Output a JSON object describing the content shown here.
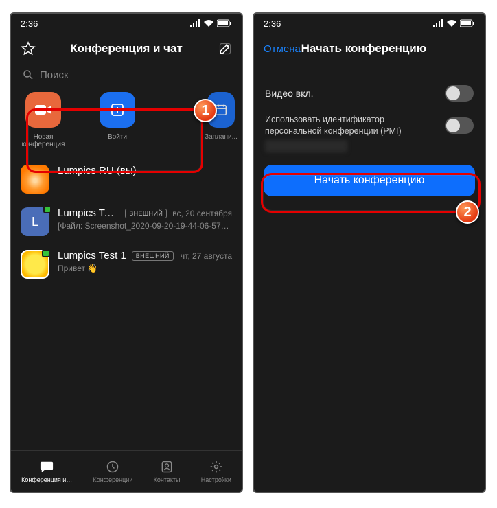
{
  "status": {
    "time": "2:36"
  },
  "screen1": {
    "title": "Конференция и чат",
    "search_placeholder": "Поиск",
    "actions": {
      "new": "Новая конференция",
      "join": "Войти",
      "schedule": "Заплани..."
    },
    "chats": [
      {
        "name": "Lumpics RU (вы)",
        "sub": "",
        "date": "",
        "avatar": "orange",
        "ext": false
      },
      {
        "name": "Lumpics  Tes…",
        "sub": "[Файл: Screenshot_2020-09-20-19-44-06-575_…",
        "date": "вс, 20 сентября",
        "avatar": "blue",
        "letter": "L",
        "ext": true
      },
      {
        "name": "Lumpics Test 1",
        "sub": "Привет 👋",
        "date": "чт, 27 августа",
        "avatar": "lemon",
        "ext": true
      }
    ],
    "nav": {
      "meet": "Конференция и…",
      "conf": "Конференции",
      "contacts": "Контакты",
      "settings": "Настройки"
    }
  },
  "screen2": {
    "cancel": "Отмена",
    "title": "Начать конференцию",
    "video_label": "Видео вкл.",
    "pmi_label": "Использовать идентификатор персональной конференции (PMI)",
    "start_button": "Начать конференцию"
  },
  "badges": {
    "one": "1",
    "two": "2"
  }
}
